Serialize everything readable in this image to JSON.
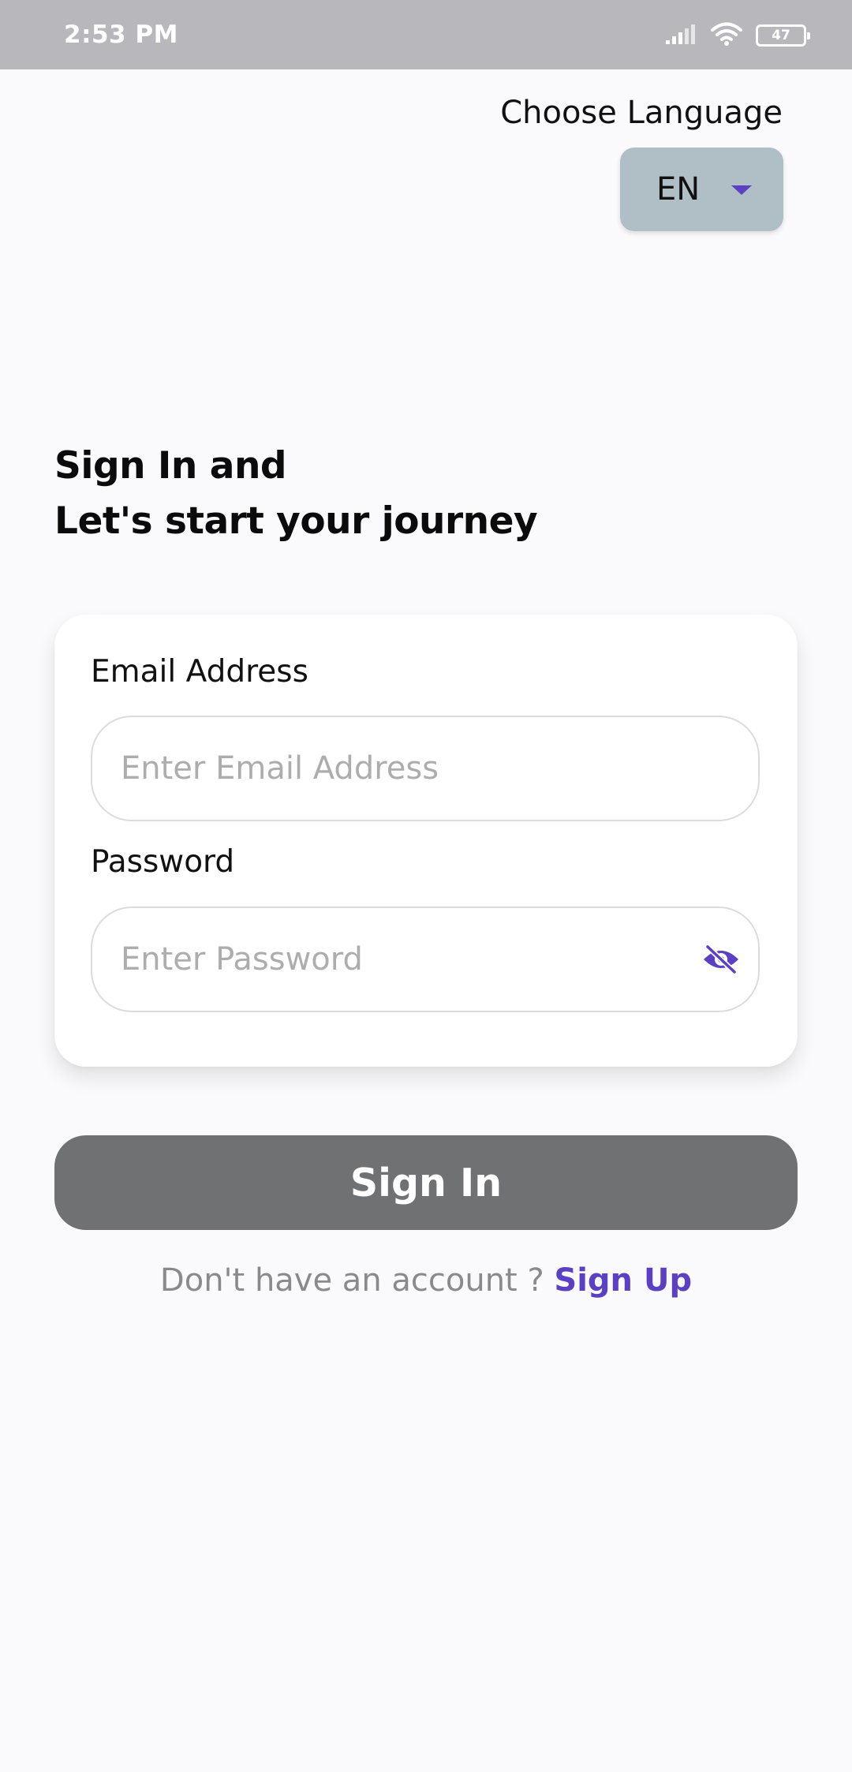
{
  "status_bar": {
    "time": "2:53 PM",
    "battery_level": "47",
    "icons": [
      "signal-icon",
      "wifi-icon",
      "battery-icon"
    ]
  },
  "language": {
    "label": "Choose Language",
    "selected": "EN"
  },
  "headline": {
    "line1": "Sign In and",
    "line2": "Let's start your journey"
  },
  "form": {
    "email_label": "Email Address",
    "email_placeholder": "Enter Email Address",
    "email_value": "",
    "password_label": "Password",
    "password_placeholder": "Enter Password",
    "password_value": ""
  },
  "actions": {
    "signin_label": "Sign In",
    "signup_prompt": "Don't have an account ? ",
    "signup_link": "Sign Up"
  },
  "colors": {
    "accent": "#5b3fc4",
    "button_bg": "#707173",
    "language_pill_bg": "#b0bec5",
    "status_bar_bg": "#b8b7bc"
  }
}
